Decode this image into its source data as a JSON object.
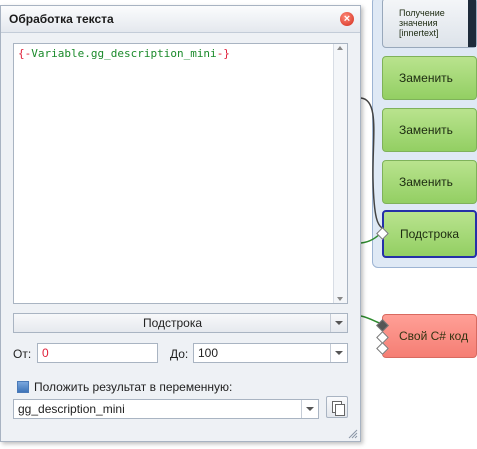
{
  "dialog": {
    "title": "Обработка текста",
    "editor_text_open": "{-",
    "editor_text_var": "Variable.gg_description_mini",
    "editor_text_close": "-}",
    "mode_value": "Подстрока",
    "from_label": "От:",
    "from_value": "0",
    "to_label": "До:",
    "to_value": "100",
    "save_label": "Положить результат в переменную:",
    "variable_value": "gg_description_mini"
  },
  "canvas": {
    "blocks": [
      {
        "label": "Получение значения [innertext]"
      },
      {
        "label": "Заменить"
      },
      {
        "label": "Заменить"
      },
      {
        "label": "Заменить"
      },
      {
        "label": "Подстрока"
      },
      {
        "label": "Свой C# код"
      }
    ]
  },
  "icons": {
    "close": "close-icon",
    "dropdown": "chevron-down-icon",
    "copy": "copy-icon",
    "checkbox": "checkbox-icon",
    "resize": "resize-grip-icon"
  },
  "colors": {
    "action_block": "#93cf63",
    "selected_border": "#2530a8",
    "csharp_block": "#f57e74",
    "variable_text": "#1a8a2a",
    "macro_text": "#e0203a"
  }
}
